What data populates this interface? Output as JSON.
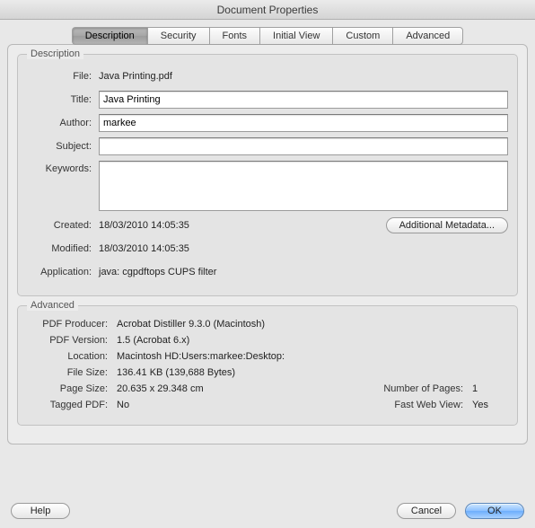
{
  "window": {
    "title": "Document Properties"
  },
  "tabs": {
    "description": "Description",
    "security": "Security",
    "fonts": "Fonts",
    "initial_view": "Initial View",
    "custom": "Custom",
    "advanced": "Advanced"
  },
  "group_desc": {
    "legend": "Description",
    "file_label": "File:",
    "file_value": "Java Printing.pdf",
    "title_label": "Title:",
    "title_value": "Java Printing",
    "author_label": "Author:",
    "author_value": "markee",
    "subject_label": "Subject:",
    "subject_value": "",
    "keywords_label": "Keywords:",
    "keywords_value": "",
    "created_label": "Created:",
    "created_value": "18/03/2010 14:05:35",
    "modified_label": "Modified:",
    "modified_value": "18/03/2010 14:05:35",
    "application_label": "Application:",
    "application_value": "java: cgpdftops CUPS filter",
    "metadata_button": "Additional Metadata..."
  },
  "group_adv": {
    "legend": "Advanced",
    "producer_label": "PDF Producer:",
    "producer_value": "Acrobat Distiller 9.3.0 (Macintosh)",
    "version_label": "PDF Version:",
    "version_value": "1.5 (Acrobat 6.x)",
    "location_label": "Location:",
    "location_value": "Macintosh HD:Users:markee:Desktop:",
    "filesize_label": "File Size:",
    "filesize_value": "136.41 KB (139,688 Bytes)",
    "pagesize_label": "Page Size:",
    "pagesize_value": "20.635 x 29.348 cm",
    "numpages_label": "Number of Pages:",
    "numpages_value": "1",
    "tagged_label": "Tagged PDF:",
    "tagged_value": "No",
    "fastweb_label": "Fast Web View:",
    "fastweb_value": "Yes"
  },
  "buttons": {
    "help": "Help",
    "cancel": "Cancel",
    "ok": "OK"
  }
}
